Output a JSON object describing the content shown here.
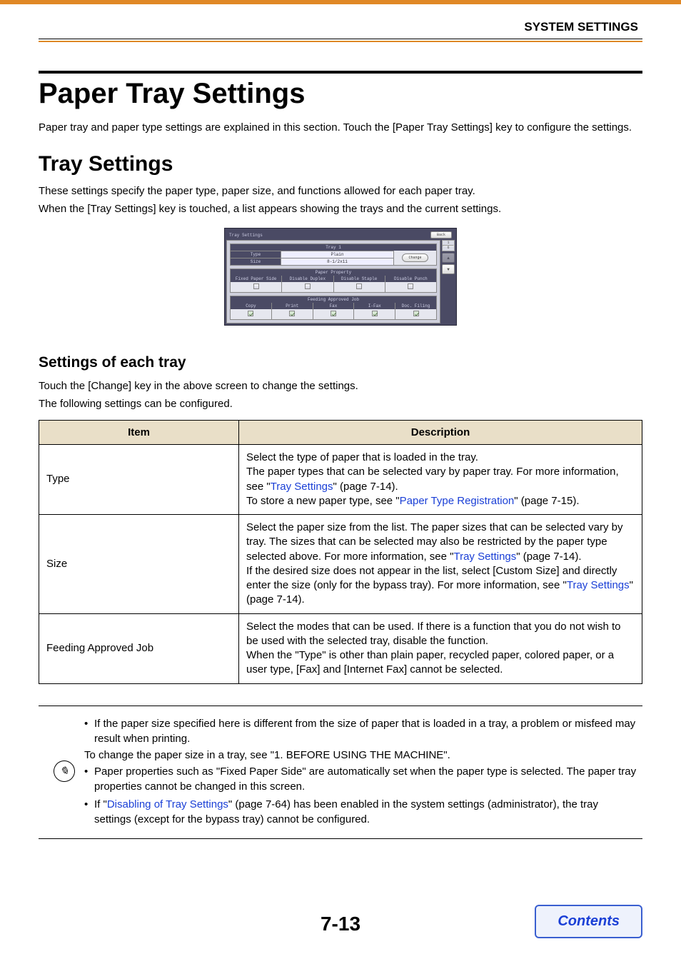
{
  "header": {
    "section": "SYSTEM SETTINGS"
  },
  "title": "Paper Tray Settings",
  "intro": "Paper tray and paper type settings are explained in this section. Touch the [Paper Tray Settings] key to configure the settings.",
  "tray_settings": {
    "heading": "Tray Settings",
    "para1": "These settings specify the paper type, paper size, and functions allowed for each paper tray.",
    "para2": "When the [Tray Settings] key is touched, a list appears showing the trays and the current settings."
  },
  "shot": {
    "title": "Tray Settings",
    "back": "Back",
    "tray_label": "Tray 1",
    "type_label": "Type",
    "size_label": "Size",
    "type_value": "Plain",
    "size_value": "8-1/2x11",
    "change": "Change",
    "page_top": "1",
    "page_bottom": "6",
    "prop_header": "Paper Property",
    "props": [
      "Fixed Paper Side",
      "Disable Duplex",
      "Disable Staple",
      "Disable Punch"
    ],
    "feed_header": "Feeding Approved Job",
    "jobs": [
      "Copy",
      "Print",
      "Fax",
      "I-Fax",
      "Doc. Filing"
    ]
  },
  "each_tray": {
    "heading": "Settings of each tray",
    "para1": "Touch the [Change] key in the above screen to change the settings.",
    "para2": "The following settings can be configured."
  },
  "table": {
    "col_item": "Item",
    "col_desc": "Description",
    "rows": [
      {
        "item": "Type",
        "desc_pre": "Select the type of paper that is loaded in the tray.\nThe paper types that can be selected vary by paper tray. For more information, see \"",
        "link1": "Tray Settings",
        "mid1": "\" (page 7-14).\nTo store a new paper type, see \"",
        "link2": "Paper Type Registration",
        "post": "\" (page 7-15)."
      },
      {
        "item": "Size",
        "desc_pre": "Select the paper size from the list. The paper sizes that can be selected vary by tray. The sizes that can be selected may also be restricted by the paper type selected above. For more information, see \"",
        "link1": "Tray Settings",
        "mid1": "\" (page 7-14).\nIf the desired size does not appear in the list, select [Custom Size] and directly enter the size (only for the bypass tray). For more information, see \"",
        "link2": "Tray Settings",
        "post": "\" (page 7-14)."
      },
      {
        "item": "Feeding Approved Job",
        "desc_plain": "Select the modes that can be used. If there is a function that you do not wish to be used with the selected tray, disable the function.\nWhen the \"Type\" is other than plain paper, recycled paper, colored paper, or a user type, [Fax] and [Internet Fax] cannot be selected."
      }
    ]
  },
  "notes": {
    "n1": "If the paper size specified here is different from the size of paper that is loaded in a tray, a problem or misfeed may result when printing.",
    "n1b": "To change the paper size in a tray, see \"1. BEFORE USING THE MACHINE\".",
    "n2": "Paper properties such as \"Fixed Paper Side\" are automatically set when the paper type is selected. The paper tray properties cannot be changed in this screen.",
    "n3_pre": "If \"",
    "n3_link": "Disabling of Tray Settings",
    "n3_post": "\" (page 7-64) has been enabled in the system settings (administrator), the tray settings (except for the bypass tray) cannot be configured."
  },
  "footer": {
    "page": "7-13",
    "contents": "Contents"
  }
}
